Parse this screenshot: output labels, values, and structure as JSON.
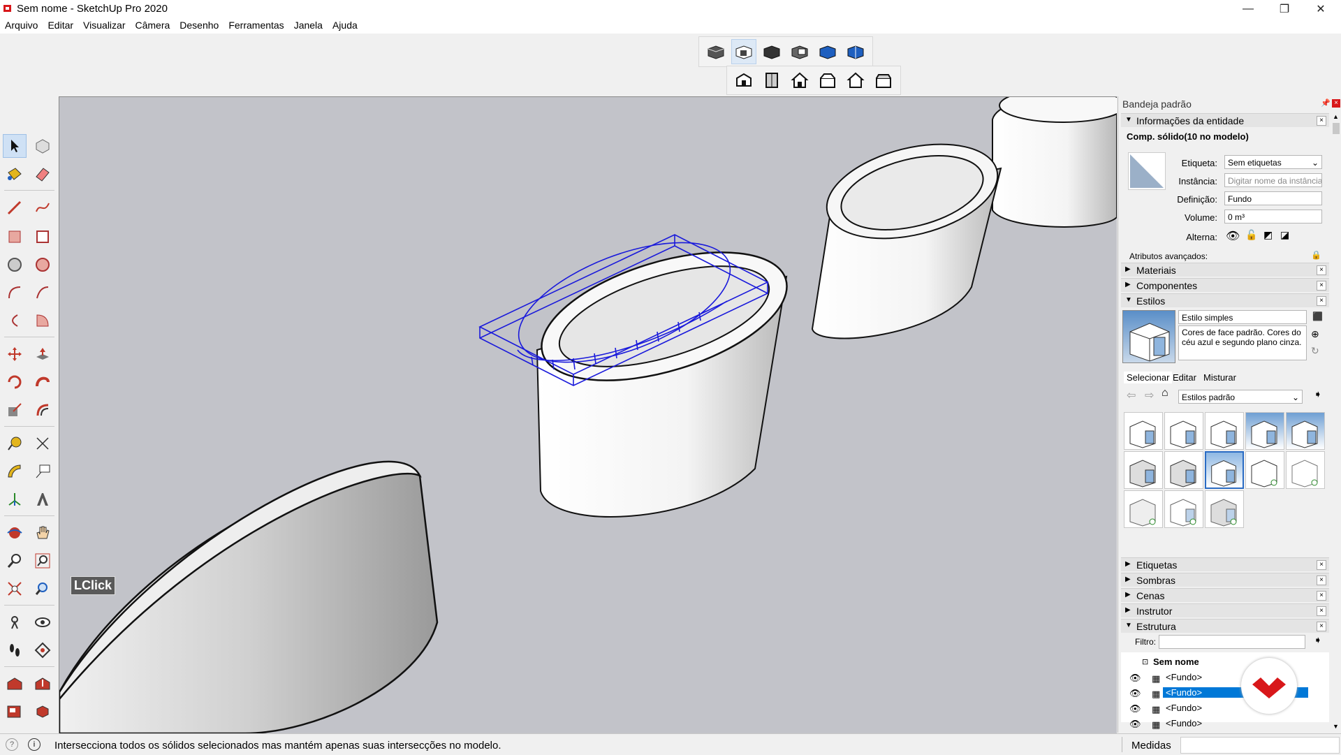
{
  "window": {
    "title": "Sem nome - SketchUp Pro 2020",
    "buttons": {
      "minimize": "—",
      "maximize": "❐",
      "close": "✕"
    }
  },
  "menu": [
    "Arquivo",
    "Editar",
    "Visualizar",
    "Câmera",
    "Desenho",
    "Ferramentas",
    "Janela",
    "Ajuda"
  ],
  "toolbars": {
    "solid_tools": [
      "solid-inspector-icon",
      "intersect-icon",
      "union-icon",
      "subtract-icon",
      "trim-icon",
      "split-icon"
    ],
    "views": [
      "iso-view-icon",
      "top-view-icon",
      "front-view-icon",
      "right-view-icon",
      "back-view-icon",
      "left-view-icon"
    ]
  },
  "viewport": {
    "overlay_label": "LClick"
  },
  "tray": {
    "title": "Bandeja padrão",
    "entity_info": {
      "section": "Informações da entidade",
      "header": "Comp. sólido(10 no modelo)",
      "tag_label": "Etiqueta:",
      "tag_value": "Sem etiquetas",
      "instance_label": "Instância:",
      "instance_placeholder": "Digitar nome da instância",
      "definition_label": "Definição:",
      "definition_value": "Fundo",
      "volume_label": "Volume:",
      "volume_value": "0 m³",
      "toggles_label": "Alterna:",
      "advanced_label": "Atributos avançados:"
    },
    "sections": {
      "materials": "Materiais",
      "components": "Componentes",
      "styles": "Estilos",
      "tags": "Etiquetas",
      "shadows": "Sombras",
      "scenes": "Cenas",
      "instructor": "Instrutor",
      "outliner": "Estrutura"
    },
    "styles": {
      "name": "Estilo simples",
      "description": "Cores de face padrão. Cores do céu azul e segundo plano cinza.",
      "tabs": [
        "Selecionar",
        "Editar",
        "Misturar"
      ],
      "collection": "Estilos padrão"
    },
    "outliner": {
      "filter_label": "Filtro:",
      "root": "Sem nome",
      "items": [
        "<Fundo>",
        "<Fundo>",
        "<Fundo>",
        "<Fundo>"
      ]
    }
  },
  "status": {
    "message": "Intersecciona todos os sólidos selecionados mas mantém apenas suas intersecções no modelo.",
    "measurements_label": "Medidas"
  },
  "colors": {
    "viewport_bg": "#c2c3c9",
    "selection_blue": "#1a1adb",
    "accent_red": "#d8171a",
    "highlight": "#0078d7"
  }
}
